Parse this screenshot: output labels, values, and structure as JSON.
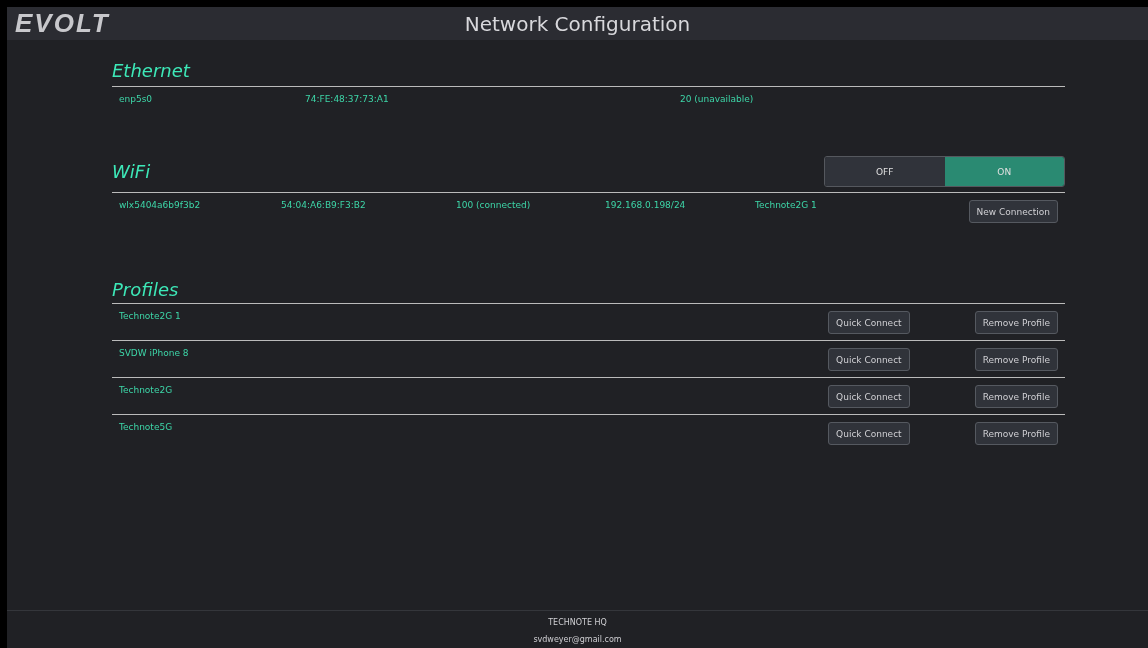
{
  "header": {
    "logo": "EVOLT",
    "title": "Network Configuration"
  },
  "ethernet": {
    "title": "Ethernet",
    "device": "enp5s0",
    "mac": "74:FE:48:37:73:A1",
    "state": "20 (unavailable)"
  },
  "wifi": {
    "title": "WiFi",
    "toggle": [
      {
        "label": "OFF",
        "selected": false
      },
      {
        "label": "ON",
        "selected": true
      }
    ],
    "device": "wlx5404a6b9f3b2",
    "mac": "54:04:A6:B9:F3:B2",
    "state": "100 (connected)",
    "ip": "192.168.0.198/24",
    "ssid": "Technote2G 1",
    "button": "New Connection"
  },
  "profiles": {
    "title": "Profiles",
    "items": [
      {
        "name": "Technote2G 1",
        "connect": "Quick Connect",
        "remove": "Remove Profile"
      },
      {
        "name": "SVDW iPhone 8",
        "connect": "Quick Connect",
        "remove": "Remove Profile"
      },
      {
        "name": "Technote2G",
        "connect": "Quick Connect",
        "remove": "Remove Profile"
      },
      {
        "name": "Technote5G",
        "connect": "Quick Connect",
        "remove": "Remove Profile"
      }
    ]
  },
  "footer": {
    "name": "TECHNOTE HQ",
    "email": "svdweyer@gmail.com"
  }
}
